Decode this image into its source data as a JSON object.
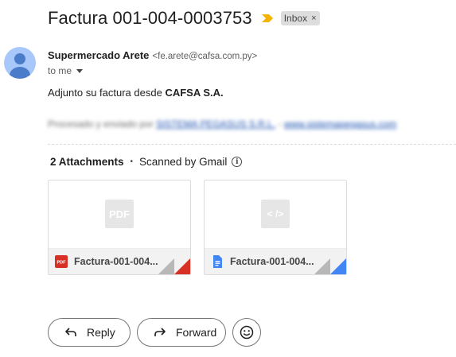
{
  "email": {
    "subject": "Factura 001-004-0003753",
    "label": "Inbox",
    "label_remove": "×",
    "sender": {
      "name": "Supermercado Arete",
      "email": "<fe.arete@cafsa.com.py>"
    },
    "to": "to me",
    "body": {
      "text_prefix": "Adjunto su factura desde ",
      "company": "CAFSA S.A."
    },
    "blurred_line": {
      "prefix": "Procesado y enviado por ",
      "link1": "SISTEMA PEGASUS S.R.L.",
      "separator": " - ",
      "link2": "www.sistemapegasus.com"
    }
  },
  "attachments": {
    "count_label": "2 Attachments",
    "scanned_label": "Scanned by Gmail",
    "info_glyph": "i",
    "items": [
      {
        "name": "Factura-001-004...",
        "preview_label": "PDF",
        "type_icon": "pdf-icon",
        "accent_color": "#d93025"
      },
      {
        "name": "Factura-001-004...",
        "preview_label": "< />",
        "type_icon": "doc-icon",
        "accent_color": "#4285f4"
      }
    ]
  },
  "actions": {
    "reply": "Reply",
    "forward": "Forward",
    "emoji": "emoji-reaction-icon"
  },
  "colors": {
    "importance_marker": "#f4b400",
    "avatar_bg": "#a8c7fa",
    "avatar_fg": "#4a7cc9",
    "pdf_red": "#d93025",
    "doc_blue": "#4285f4"
  }
}
